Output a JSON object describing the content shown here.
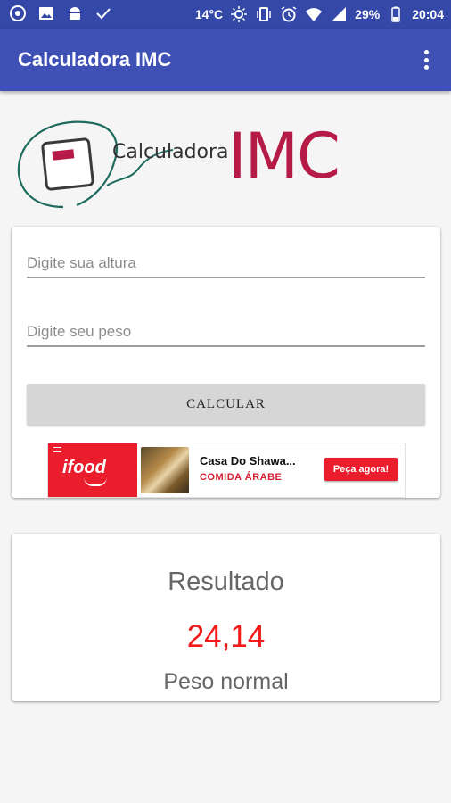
{
  "status_bar": {
    "temperature": "14°C",
    "battery": "29%",
    "time": "20:04",
    "left_icons": [
      "chrome-icon",
      "image-icon",
      "android-icon",
      "check-icon"
    ],
    "right_icons": [
      "sun-icon",
      "vibrate-icon",
      "alarm-icon",
      "wifi-icon",
      "signal-icon",
      "battery-icon"
    ]
  },
  "app_bar": {
    "title": "Calculadora IMC",
    "menu_icon": "more-vert-icon"
  },
  "logo": {
    "text": "Calculadora",
    "accent": "IMC",
    "accent_color": "#b51b46",
    "ring_color": "#1f6b5e"
  },
  "form": {
    "height_placeholder": "Digite sua altura",
    "weight_placeholder": "Digite seu peso",
    "height_value": "",
    "weight_value": "",
    "calc_button": "CALCULAR"
  },
  "ad": {
    "brand": "ifood",
    "restaurant": "Casa Do Shawa...",
    "category": "COMIDA ÁRABE",
    "cta": "Peça agora!",
    "brand_color": "#ea1d2c"
  },
  "result": {
    "title": "Resultado",
    "value": "24,14",
    "status": "Peso normal",
    "value_color": "#f21b1b"
  },
  "colors": {
    "primary": "#3f51b5",
    "primary_dark": "#3448a8"
  }
}
